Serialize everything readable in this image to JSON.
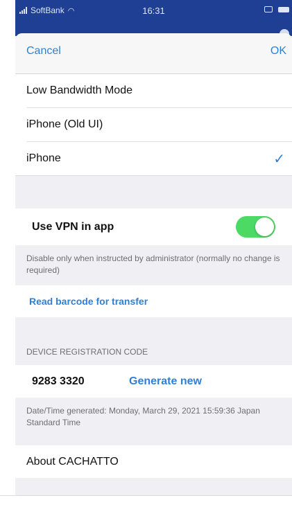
{
  "status_bar": {
    "carrier": "SoftBank",
    "time": "16:31"
  },
  "navbar": {
    "cancel_label": "Cancel",
    "ok_label": "OK"
  },
  "ui_modes": {
    "items": [
      {
        "label": "Low Bandwidth Mode",
        "selected": false
      },
      {
        "label": "iPhone (Old UI)",
        "selected": false
      },
      {
        "label": "iPhone",
        "selected": true
      }
    ],
    "checkmark": "✓"
  },
  "vpn": {
    "label": "Use VPN in app",
    "enabled": true,
    "note": "Disable only when instructed by administrator (normally no change is required)"
  },
  "barcode": {
    "label": "Read barcode for transfer"
  },
  "registration": {
    "header": "DEVICE REGISTRATION CODE",
    "code": "9283 3320",
    "generate_label": "Generate new",
    "generated_note": "Date/Time generated: Monday, March 29, 2021 15:59:36 Japan Standard Time"
  },
  "about": {
    "label": "About CACHATTO"
  },
  "colors": {
    "accent": "#2f7fd6",
    "toggle_on": "#4cd964",
    "status_bar_bg": "#1f3f94",
    "grouped_bg": "#efeff4"
  },
  "icons": [
    "signal-icon",
    "wifi-icon",
    "airplay-icon",
    "battery-icon",
    "checkmark-icon"
  ]
}
